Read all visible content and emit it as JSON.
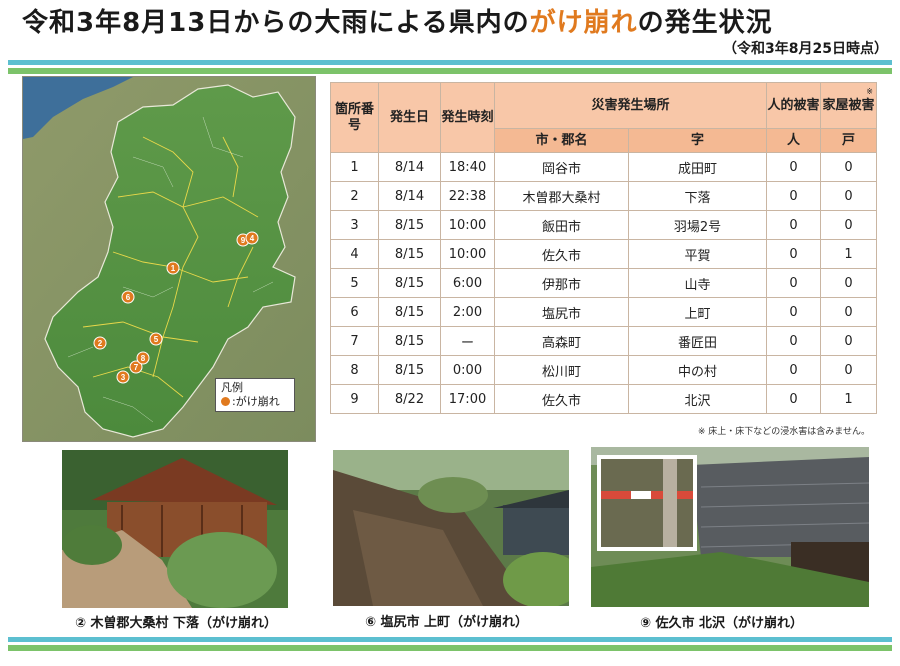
{
  "title": {
    "prefix": "令和3年8月13日からの大雨による県内の",
    "highlight": "がけ崩れ",
    "suffix": "の発生状況"
  },
  "as_of": "（令和3年8月25日時点）",
  "colors": {
    "accent": "#e07a1f",
    "header_bg": "#f8c7a8",
    "band_blue": "#5cbfd0",
    "band_green": "#7cc36a"
  },
  "map": {
    "markers": [
      "1",
      "2",
      "3",
      "5",
      "6",
      "7",
      "8",
      "9",
      "4"
    ],
    "legend_title": "凡例",
    "legend_item": ":がけ崩れ",
    "legend_icon": "orange-dot-icon"
  },
  "table": {
    "headers": {
      "no": "箇所番号",
      "date": "発生日",
      "time": "発生時刻",
      "place": "災害発生場所",
      "city": "市・郡名",
      "aza": "字",
      "human": "人的被害",
      "human_unit": "人",
      "house": "家屋被害",
      "house_mark": "※",
      "house_unit": "戸"
    },
    "rows": [
      [
        "1",
        "8/14",
        "18:40",
        "岡谷市",
        "成田町",
        "0",
        "0"
      ],
      [
        "2",
        "8/14",
        "22:38",
        "木曽郡大桑村",
        "下落",
        "0",
        "0"
      ],
      [
        "3",
        "8/15",
        "10:00",
        "飯田市",
        "羽場2号",
        "0",
        "0"
      ],
      [
        "4",
        "8/15",
        "10:00",
        "佐久市",
        "平賀",
        "0",
        "1"
      ],
      [
        "5",
        "8/15",
        "6:00",
        "伊那市",
        "山寺",
        "0",
        "0"
      ],
      [
        "6",
        "8/15",
        "2:00",
        "塩尻市",
        "上町",
        "0",
        "0"
      ],
      [
        "7",
        "8/15",
        "ー",
        "高森町",
        "番匠田",
        "0",
        "0"
      ],
      [
        "8",
        "8/15",
        "0:00",
        "松川町",
        "中の村",
        "0",
        "0"
      ],
      [
        "9",
        "8/22",
        "17:00",
        "佐久市",
        "北沢",
        "0",
        "1"
      ]
    ],
    "note": "※ 床上・床下などの浸水害は含みません。"
  },
  "photos": [
    {
      "caption": "② 木曽郡大桑村 下落（がけ崩れ）"
    },
    {
      "caption": "⑥ 塩尻市 上町（がけ崩れ）"
    },
    {
      "caption": "⑨ 佐久市 北沢（がけ崩れ）"
    }
  ]
}
